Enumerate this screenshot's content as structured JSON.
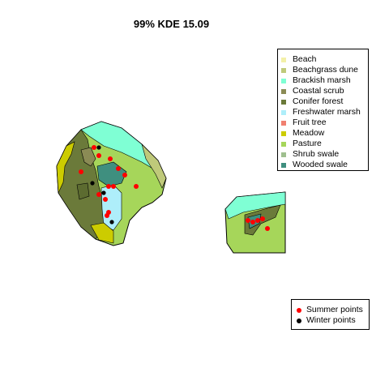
{
  "title": "99% KDE 15.09",
  "habitat_legend": [
    {
      "label": "Beach",
      "color": "#f3f0a8"
    },
    {
      "label": "Beachgrass dune",
      "color": "#bfc97a"
    },
    {
      "label": "Brackish marsh",
      "color": "#7fffd4"
    },
    {
      "label": "Coastal scrub",
      "color": "#8b8b55"
    },
    {
      "label": "Conifer forest",
      "color": "#6b7a3a"
    },
    {
      "label": "Freshwater marsh",
      "color": "#aeeefa"
    },
    {
      "label": "Fruit tree",
      "color": "#f08070"
    },
    {
      "label": "Meadow",
      "color": "#cccc00"
    },
    {
      "label": "Pasture",
      "color": "#a6d65a"
    },
    {
      "label": "Shrub swale",
      "color": "#9fbf8f"
    },
    {
      "label": "Wooded swale",
      "color": "#3f8f7f"
    }
  ],
  "points_legend": [
    {
      "label": "Summer points",
      "color": "#ff0000"
    },
    {
      "label": "Winter points",
      "color": "#000000"
    }
  ]
}
